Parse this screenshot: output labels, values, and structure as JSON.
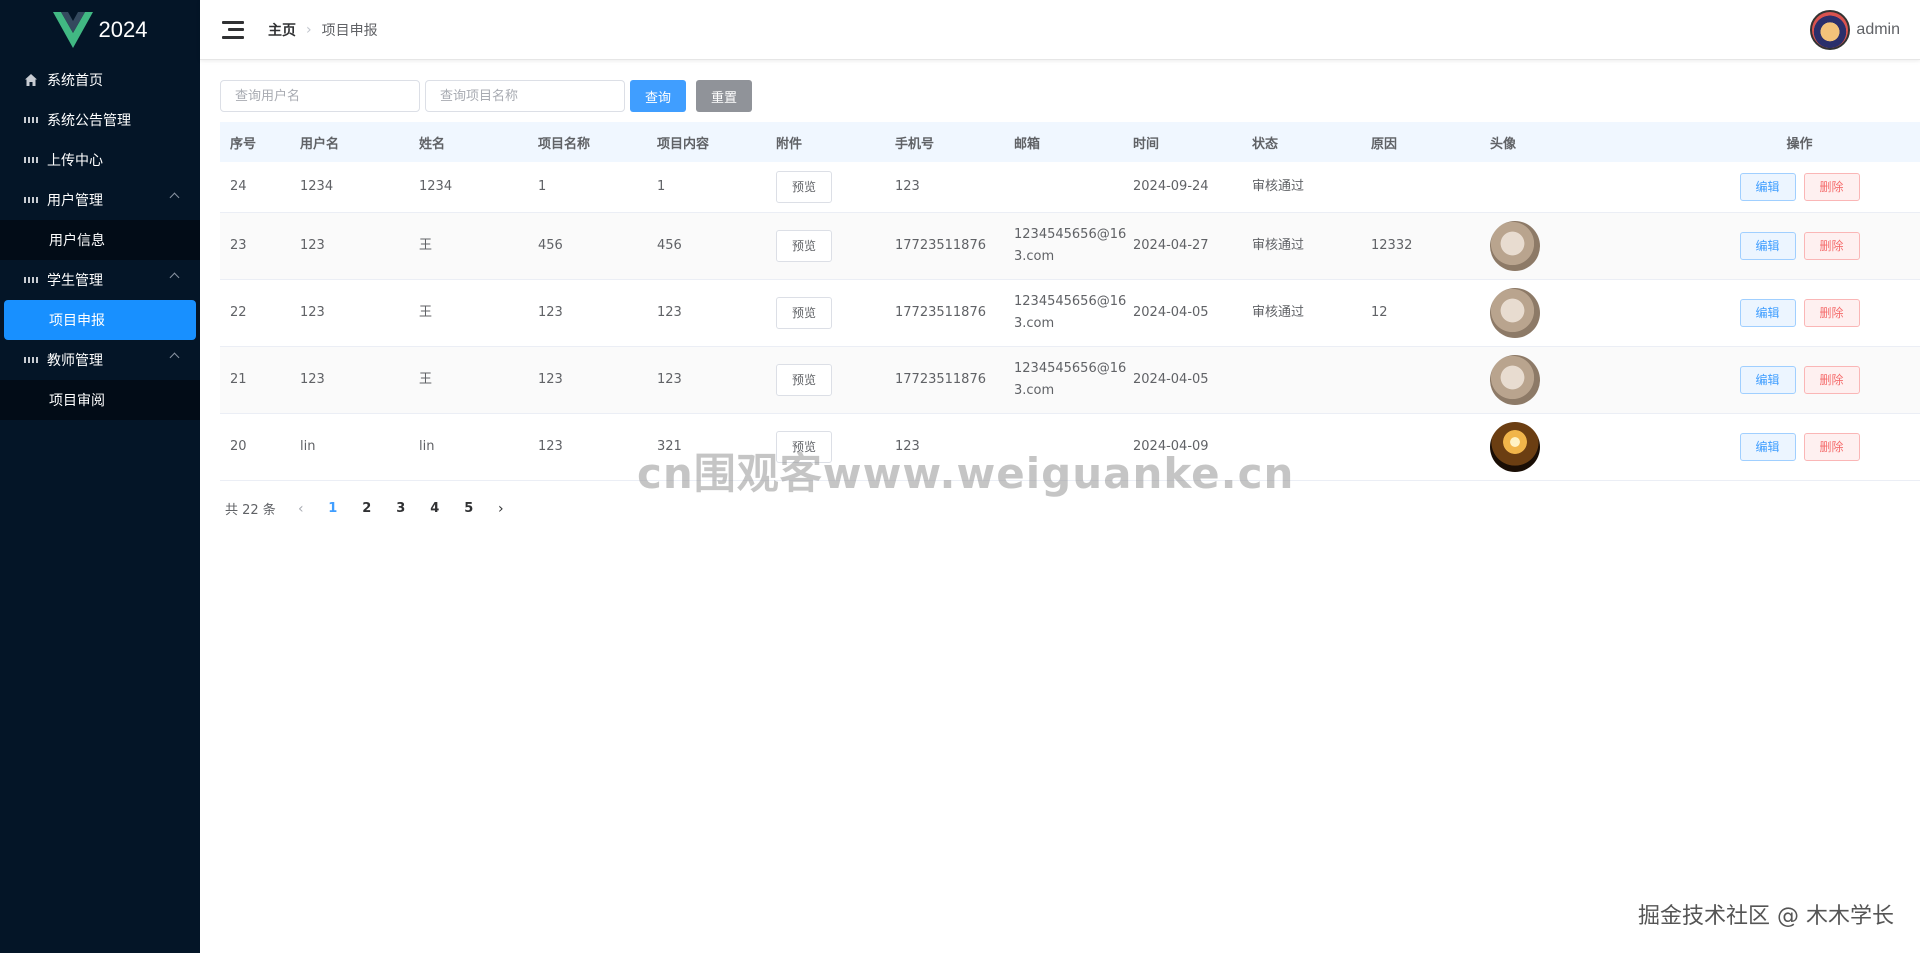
{
  "app": {
    "logo_text": "2024"
  },
  "sidebar": {
    "items": [
      {
        "label": "系统首页"
      },
      {
        "label": "系统公告管理"
      },
      {
        "label": "上传中心"
      },
      {
        "label": "用户管理",
        "children": [
          {
            "label": "用户信息"
          }
        ]
      },
      {
        "label": "学生管理",
        "children": [
          {
            "label": "项目申报"
          }
        ]
      },
      {
        "label": "教师管理",
        "children": [
          {
            "label": "项目审阅"
          }
        ]
      }
    ]
  },
  "header": {
    "breadcrumb": {
      "home": "主页",
      "current": "项目申报"
    },
    "user_name": "admin"
  },
  "search": {
    "username_placeholder": "查询用户名",
    "project_placeholder": "查询项目名称",
    "query_label": "查询",
    "reset_label": "重置"
  },
  "table": {
    "columns": [
      "序号",
      "用户名",
      "姓名",
      "项目名称",
      "项目内容",
      "附件",
      "手机号",
      "邮箱",
      "时间",
      "状态",
      "原因",
      "头像",
      "操作"
    ],
    "preview_label": "预览",
    "edit_label": "编辑",
    "delete_label": "删除",
    "rows": [
      {
        "id": "24",
        "username": "1234",
        "name": "1234",
        "project": "1",
        "content": "1",
        "phone": "123",
        "email_1": "",
        "email_2": "",
        "date": "2024-09-24",
        "status": "审核通过",
        "reason": "",
        "avatar": "none"
      },
      {
        "id": "23",
        "username": "123",
        "name": "王",
        "project": "456",
        "content": "456",
        "phone": "17723511876",
        "email_1": "1234545656@16",
        "email_2": "3.com",
        "date": "2024-04-27",
        "status": "审核通过",
        "reason": "12332",
        "avatar": "cat"
      },
      {
        "id": "22",
        "username": "123",
        "name": "王",
        "project": "123",
        "content": "123",
        "phone": "17723511876",
        "email_1": "1234545656@16",
        "email_2": "3.com",
        "date": "2024-04-05",
        "status": "审核通过",
        "reason": "12",
        "avatar": "cat"
      },
      {
        "id": "21",
        "username": "123",
        "name": "王",
        "project": "123",
        "content": "123",
        "phone": "17723511876",
        "email_1": "1234545656@16",
        "email_2": "3.com",
        "date": "2024-04-05",
        "status": "",
        "reason": "",
        "avatar": "cat"
      },
      {
        "id": "20",
        "username": "lin",
        "name": "lin",
        "project": "123",
        "content": "321",
        "phone": "123",
        "email_1": "",
        "email_2": "",
        "date": "2024-04-09",
        "status": "",
        "reason": "",
        "avatar": "light"
      }
    ]
  },
  "pagination": {
    "total_text": "共 22 条",
    "pages": [
      "1",
      "2",
      "3",
      "4",
      "5"
    ],
    "current": "1"
  },
  "watermark": "cn围观客www.weiguanke.cn",
  "footer_mark": "掘金技术社区 @ 木木学长"
}
